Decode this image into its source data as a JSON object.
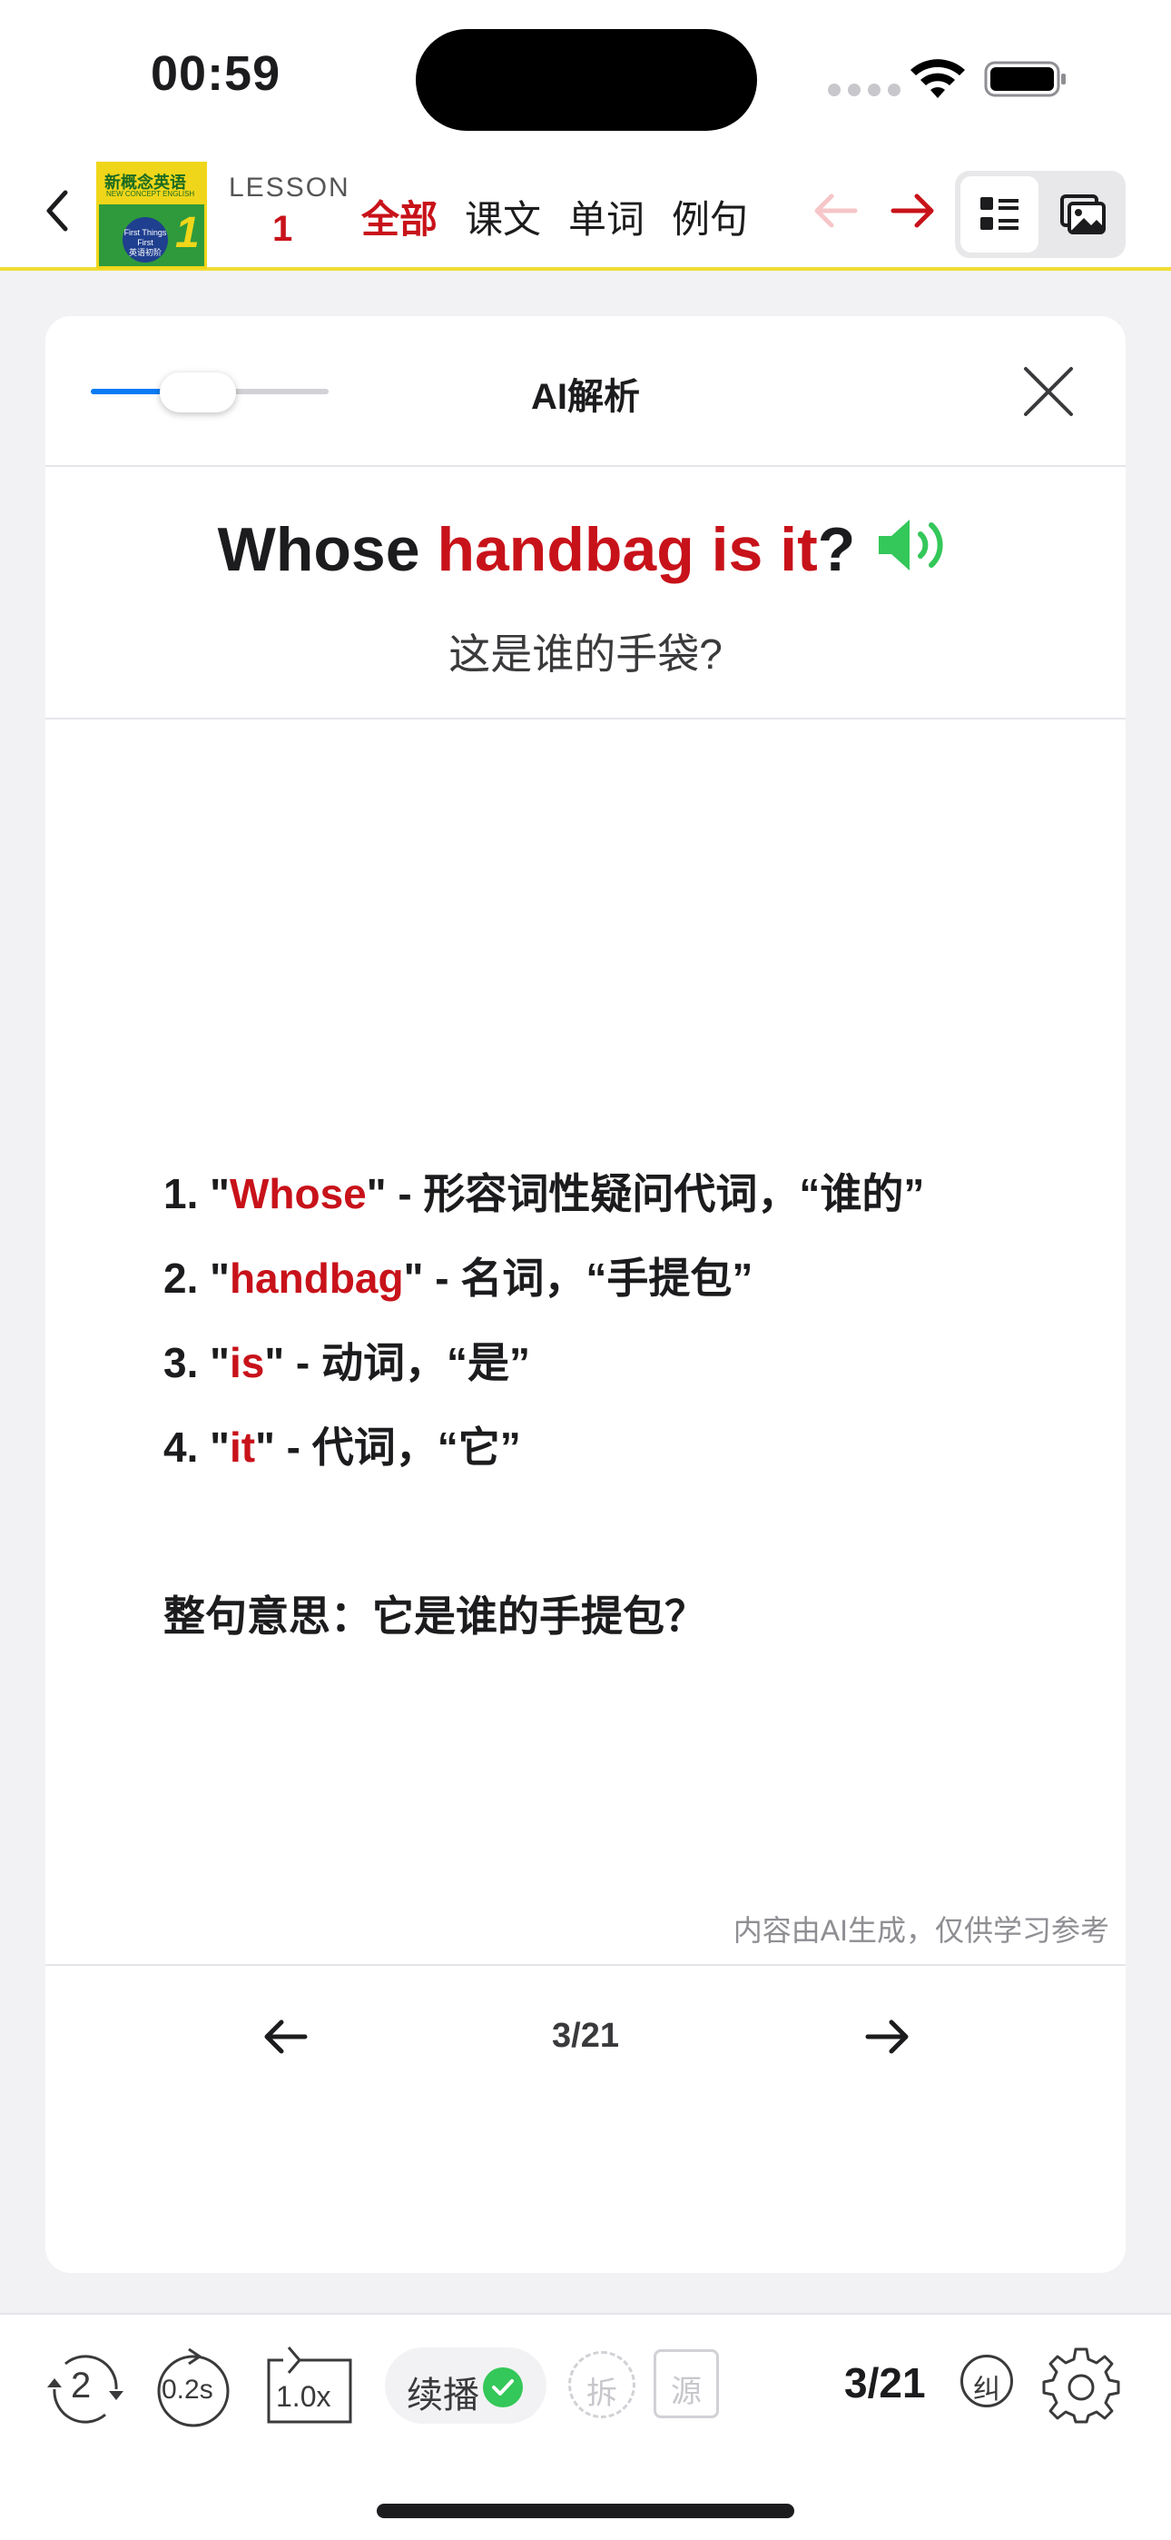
{
  "status": {
    "time": "00:59"
  },
  "nav": {
    "book": {
      "title": "新概念英语",
      "subtitle": "NEW CONCEPT ENGLISH",
      "badge": "First Things First",
      "badge_zh": "英语初阶",
      "number": "1"
    },
    "lesson_label": "LESSON",
    "lesson_number": "1",
    "tabs": [
      {
        "label": "全部",
        "active": true
      },
      {
        "label": "课文",
        "active": false
      },
      {
        "label": "单词",
        "active": false
      },
      {
        "label": "例句",
        "active": false
      }
    ]
  },
  "card": {
    "title": "AI解析",
    "slider_value": 0.45,
    "sentence": {
      "parts": [
        {
          "text": "Whose ",
          "highlight": false
        },
        {
          "text": "handbag is it",
          "highlight": true
        },
        {
          "text": "?",
          "highlight": false
        }
      ],
      "translation": "这是谁的手袋?"
    },
    "analysis": [
      {
        "prefix": "1. \"",
        "keyword": "Whose",
        "suffix": "\" - 形容词性疑问代词，“谁的”"
      },
      {
        "prefix": "2. \"",
        "keyword": "handbag",
        "suffix": "\" - 名词，“手提包”"
      },
      {
        "prefix": "3. \"",
        "keyword": "is",
        "suffix": "\" - 动词，“是”"
      },
      {
        "prefix": "4. \"",
        "keyword": "it",
        "suffix": "\" - 代词，“它”"
      }
    ],
    "summary": "整句意思：它是谁的手提包？",
    "disclaimer": "内容由AI生成，仅供学习参考",
    "pager": {
      "label": "3/21"
    }
  },
  "toolbar": {
    "repeat_count": "2",
    "delay": "0.2s",
    "speed": "1.0x",
    "continue_label": "续播",
    "split_label": "拆",
    "source_label": "源",
    "count": "3/21",
    "correct_label": "纠"
  },
  "colors": {
    "accent_red": "#c8121a",
    "speaker_green": "#34c759",
    "slider_blue": "#0a7bf5",
    "nav_underline": "#f1dd37"
  }
}
